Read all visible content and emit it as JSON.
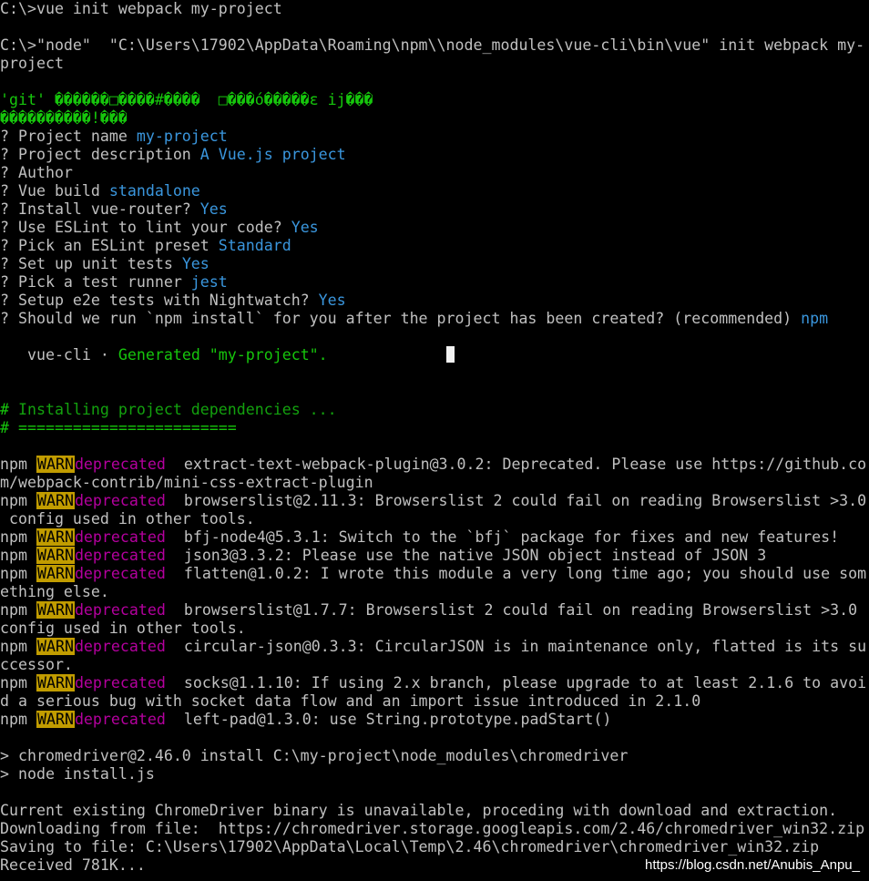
{
  "colors": {
    "background": "#000000",
    "text": "#c0c0c0",
    "answer": "#3a96dd",
    "green": "#16c60c",
    "warn_bg": "#c19c00",
    "deprecated": "#b4009e"
  },
  "prompt_cmd": "C:\\>vue init webpack my-project",
  "exec_line_1": "C:\\>\"node\"  \"C:\\Users\\17902\\AppData\\Roaming\\npm\\\\node_modules\\vue-cli\\bin\\vue\" init webpack my-",
  "exec_line_2": "project",
  "garbled_1": "'git' ������□����#����  □���ó�����ɛ ij���",
  "garbled_2": "����������!���",
  "questions": [
    {
      "q": "? Project name ",
      "a": "my-project"
    },
    {
      "q": "? Project description ",
      "a": "A Vue.js project"
    },
    {
      "q": "? Author",
      "a": ""
    },
    {
      "q": "? Vue build ",
      "a": "standalone"
    },
    {
      "q": "? Install vue-router? ",
      "a": "Yes"
    },
    {
      "q": "? Use ESLint to lint your code? ",
      "a": "Yes"
    },
    {
      "q": "? Pick an ESLint preset ",
      "a": "Standard"
    },
    {
      "q": "? Set up unit tests ",
      "a": "Yes"
    },
    {
      "q": "? Pick a test runner ",
      "a": "jest"
    },
    {
      "q": "? Setup e2e tests with Nightwatch? ",
      "a": "Yes"
    },
    {
      "q": "? Should we run `npm install` for you after the project has been created? (recommended) ",
      "a": "npm"
    }
  ],
  "generated": {
    "name": "   vue-cli",
    "bullet": " · ",
    "text": "Generated \"my-project\"."
  },
  "installing": {
    "hash1": "#",
    "title": " Installing project dependencies ...",
    "line2": "# ========================"
  },
  "npm_warn": {
    "prefix": "npm ",
    "badge": "WARN",
    "deprecated": "deprecated"
  },
  "warnings": [
    {
      "text": " extract-text-webpack-plugin@3.0.2: Deprecated. Please use https://github.co",
      "cont": "m/webpack-contrib/mini-css-extract-plugin"
    },
    {
      "text": " browserslist@2.11.3: Browserslist 2 could fail on reading Browserslist >3.0",
      "cont": " config used in other tools."
    },
    {
      "text": " bfj-node4@5.3.1: Switch to the `bfj` package for fixes and new features!",
      "cont": ""
    },
    {
      "text": " json3@3.3.2: Please use the native JSON object instead of JSON 3",
      "cont": ""
    },
    {
      "text": " flatten@1.0.2: I wrote this module a very long time ago; you should use som",
      "cont": "ething else."
    },
    {
      "text": " browserslist@1.7.7: Browserslist 2 could fail on reading Browserslist >3.0",
      "cont": "config used in other tools."
    },
    {
      "text": " circular-json@0.3.3: CircularJSON is in maintenance only, flatted is its su",
      "cont": "ccessor."
    },
    {
      "text": " socks@1.1.10: If using 2.x branch, please upgrade to at least 2.1.6 to avoi",
      "cont": "d a serious bug with socket data flow and an import issue introduced in 2.1.0"
    },
    {
      "text": " left-pad@1.3.0: use String.prototype.padStart()",
      "cont": ""
    }
  ],
  "chromedriver_1": "> chromedriver@2.46.0 install C:\\my-project\\node_modules\\chromedriver",
  "chromedriver_2": "> node install.js",
  "output": [
    "Current existing ChromeDriver binary is unavailable, proceding with download and extraction.",
    "Downloading from file:  https://chromedriver.storage.googleapis.com/2.46/chromedriver_win32.zip",
    "Saving to file: C:\\Users\\17902\\AppData\\Local\\Temp\\2.46\\chromedriver\\chromedriver_win32.zip",
    "Received 781K..."
  ],
  "watermark": "https://blog.csdn.net/Anubis_Anpu_"
}
